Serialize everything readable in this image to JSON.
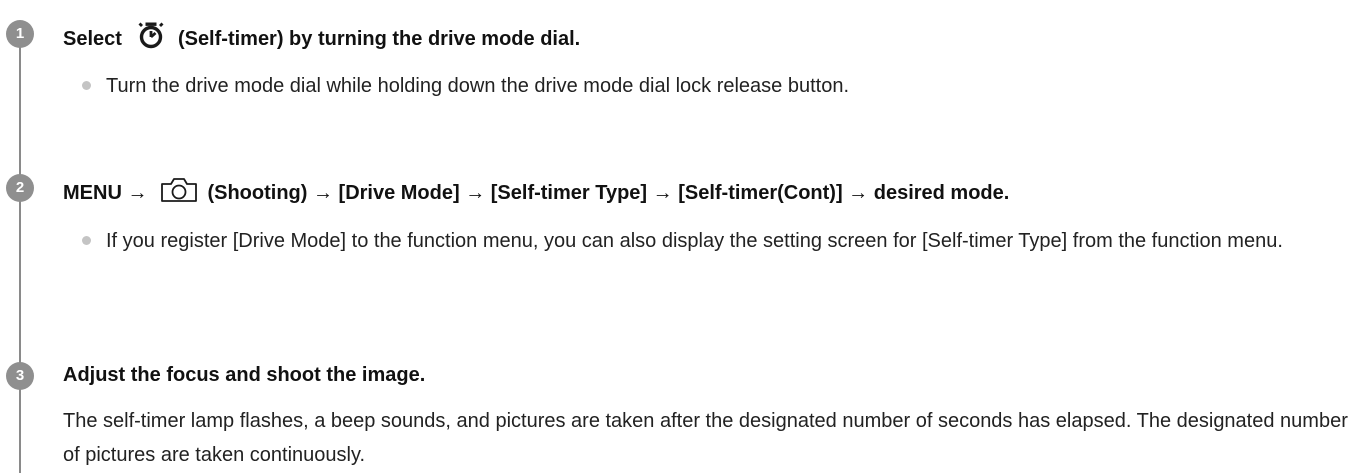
{
  "steps": [
    {
      "number": "1",
      "heading_before_icon": "Select",
      "icon": "self-timer-icon",
      "heading_after_icon": "(Self-timer) by turning the drive mode dial.",
      "bullets": [
        "Turn the drive mode dial while holding down the drive mode dial lock release button."
      ]
    },
    {
      "number": "2",
      "heading_before_icon": "MENU →",
      "icon": "camera-shooting-icon",
      "heading_after_icon": "(Shooting) → [Drive Mode] → [Self-timer Type] → [Self-timer(Cont)] → desired mode.",
      "bullets": [
        "If you register [Drive Mode] to the function menu, you can also display the setting screen for [Self-timer Type] from the function menu."
      ]
    },
    {
      "number": "3",
      "heading": "Adjust the focus and shoot the image.",
      "paragraph": "The self-timer lamp flashes, a beep sounds, and pictures are taken after the designated number of seconds has elapsed. The designated number of pictures are taken continuously."
    }
  ]
}
